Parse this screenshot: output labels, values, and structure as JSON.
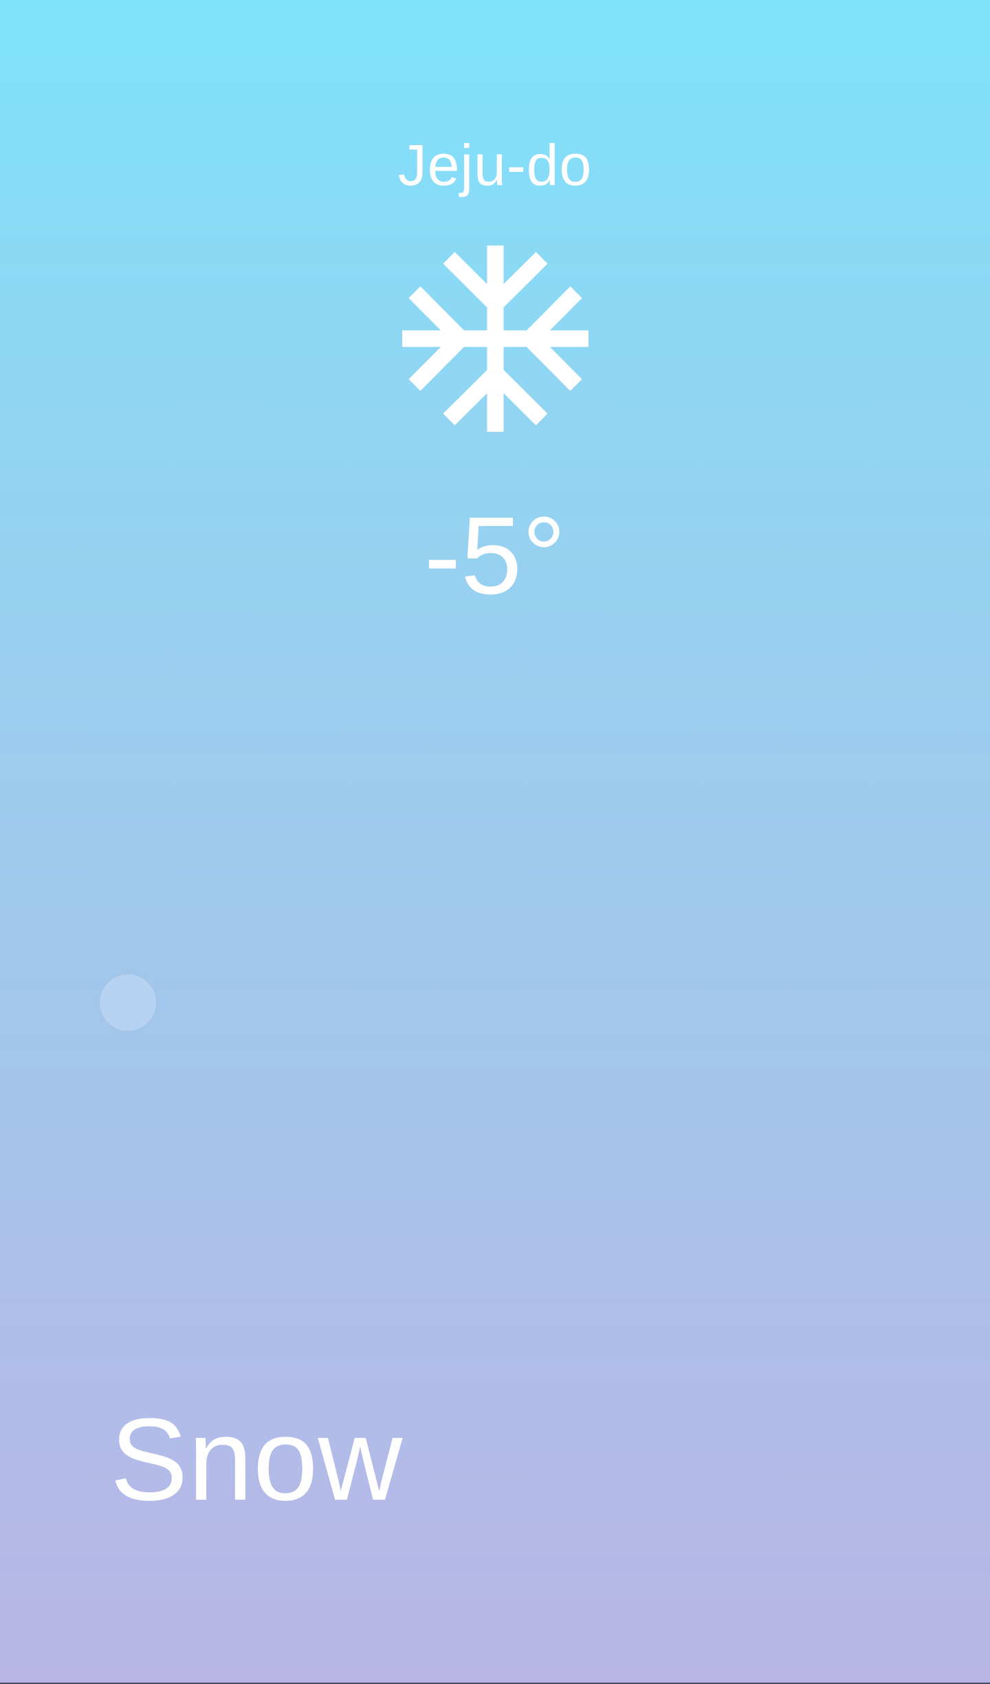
{
  "weather": {
    "location": "Jeju-do",
    "icon": "snowflake-icon",
    "temperature": "-5°",
    "condition": "Snow"
  },
  "colors": {
    "gradient_top": "#7fe2fb",
    "gradient_bottom": "#b8b5e4",
    "text": "#ffffff"
  }
}
